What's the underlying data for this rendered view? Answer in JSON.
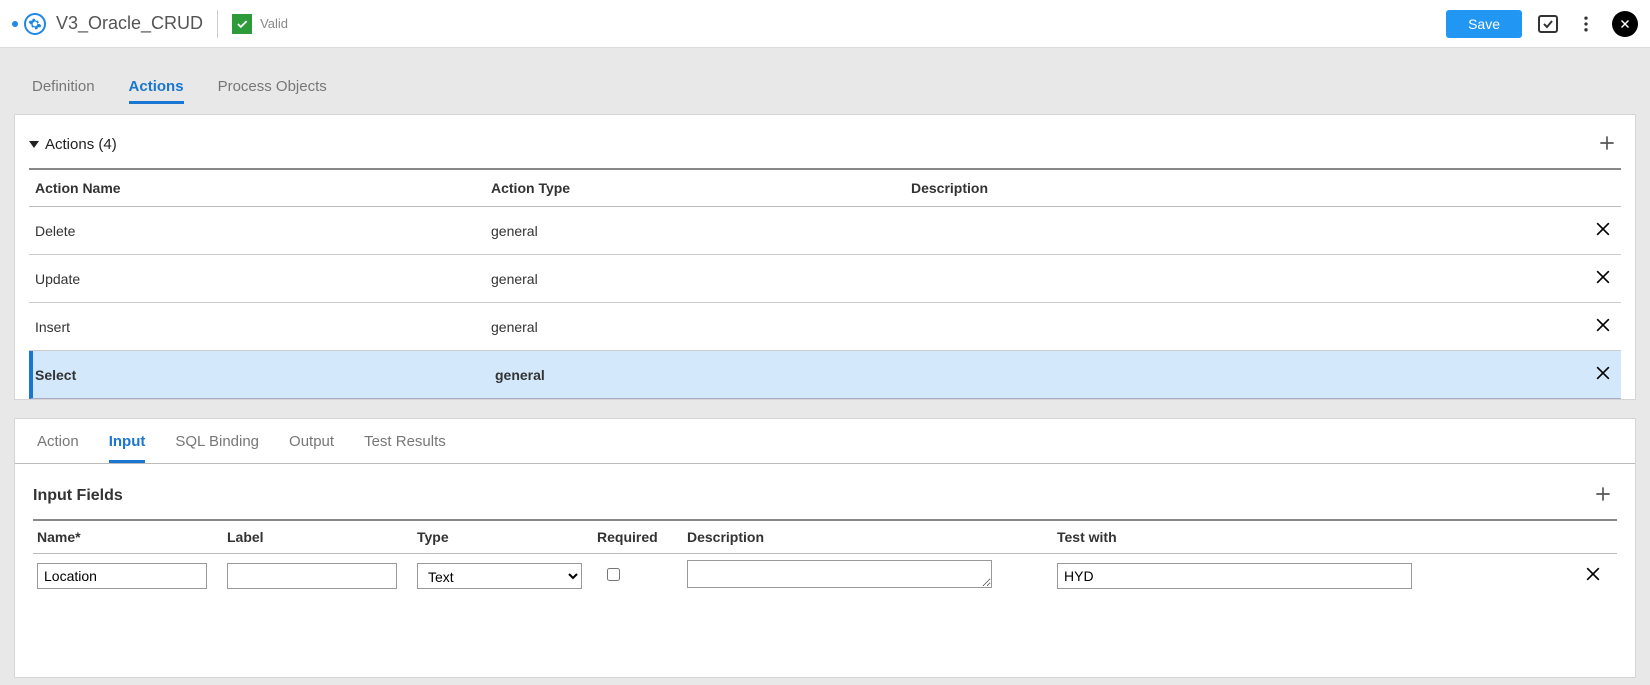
{
  "header": {
    "title": "V3_Oracle_CRUD",
    "valid_text": "Valid",
    "save_label": "Save"
  },
  "main_tabs": {
    "items": [
      {
        "label": "Definition"
      },
      {
        "label": "Actions"
      },
      {
        "label": "Process Objects"
      }
    ],
    "active_index": 1
  },
  "actions_section": {
    "title": "Actions (4)",
    "columns": {
      "name": "Action Name",
      "type": "Action Type",
      "desc": "Description"
    },
    "rows": [
      {
        "name": "Delete",
        "type": "general",
        "desc": "",
        "selected": false
      },
      {
        "name": "Update",
        "type": "general",
        "desc": "",
        "selected": false
      },
      {
        "name": "Insert",
        "type": "general",
        "desc": "",
        "selected": false
      },
      {
        "name": "Select",
        "type": "general",
        "desc": "",
        "selected": true
      }
    ]
  },
  "sub_tabs": {
    "items": [
      {
        "label": "Action"
      },
      {
        "label": "Input"
      },
      {
        "label": "SQL Binding"
      },
      {
        "label": "Output"
      },
      {
        "label": "Test Results"
      }
    ],
    "active_index": 1
  },
  "input_fields": {
    "title": "Input Fields",
    "columns": {
      "name": "Name*",
      "label": "Label",
      "type": "Type",
      "required": "Required",
      "desc": "Description",
      "test": "Test with"
    },
    "rows": [
      {
        "name": "Location",
        "label": "",
        "type": "Text",
        "required": false,
        "desc": "",
        "test": "HYD"
      }
    ]
  }
}
